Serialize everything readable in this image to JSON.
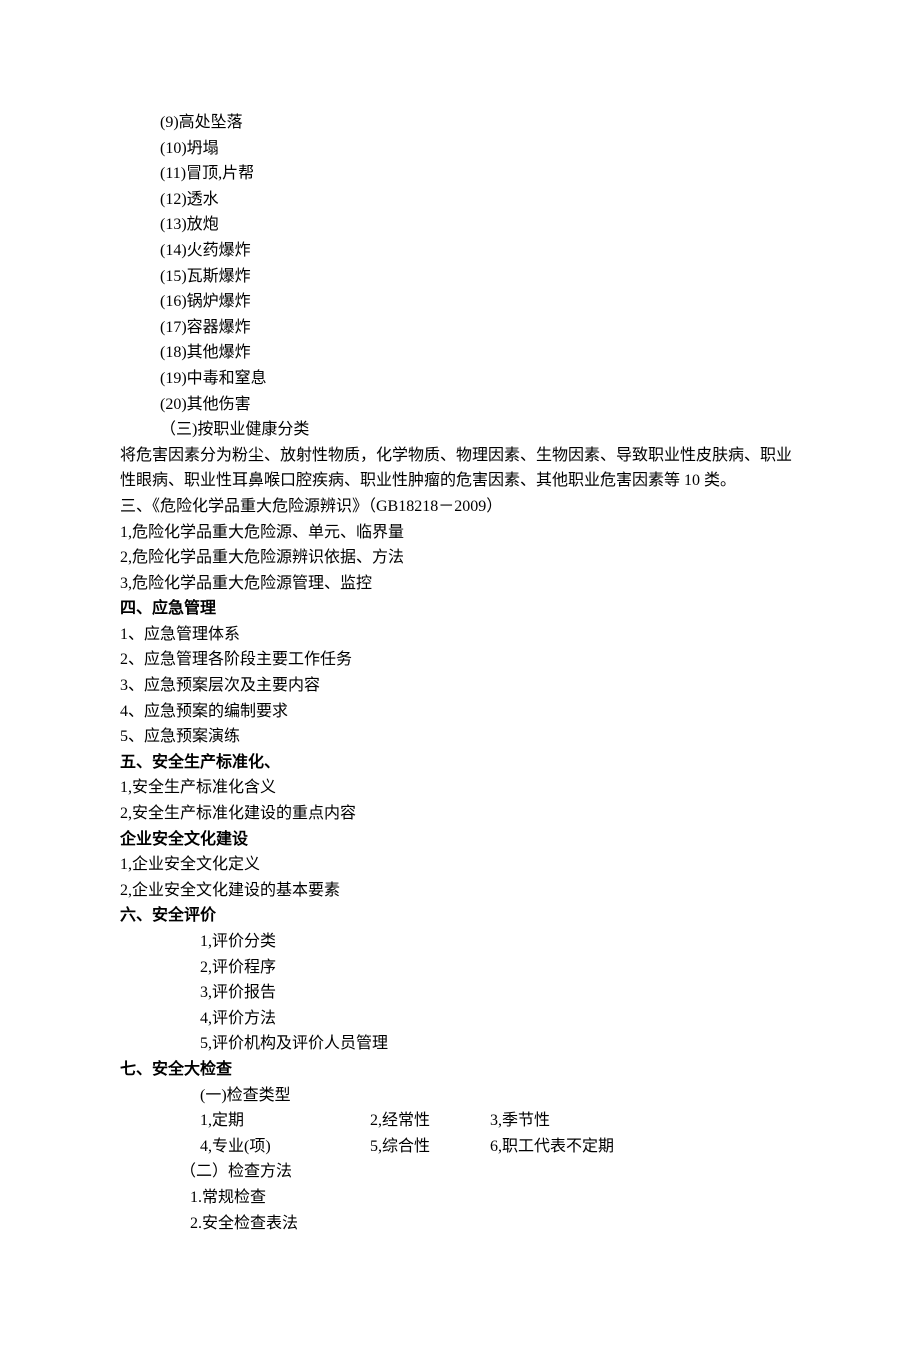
{
  "items_numbered": [
    "(9)高处坠落",
    "(10)坍塌",
    "(11)冒顶,片帮",
    "(12)透水",
    "(13)放炮",
    "(14)火药爆炸",
    "(15)瓦斯爆炸",
    "(16)锅炉爆炸",
    "(17)容器爆炸",
    "(18)其他爆炸",
    "(19)中毒和窒息",
    "(20)其他伤害"
  ],
  "section3_sub": "（三)按职业健康分类",
  "paragraph1": "将危害因素分为粉尘、放射性物质，化学物质、物理因素、生物因素、导致职业性皮肤病、职业性眼病、职业性耳鼻喉口腔疾病、职业性肿瘤的危害因素、其他职业危害因素等 10 类。",
  "section3_title": "三、《危险化学品重大危险源辨识》（GB18218－2009）",
  "section3_items": [
    "1,危险化学品重大危险源、单元、临界量",
    "2,危险化学品重大危险源辨识依据、方法",
    "3,危险化学品重大危险源管理、监控"
  ],
  "section4_title": "四、应急管理",
  "section4_items": [
    "1、应急管理体系",
    "2、应急管理各阶段主要工作任务",
    "3、应急预案层次及主要内容",
    "4、应急预案的编制要求",
    "5、应急预案演练"
  ],
  "section5_title": "五、安全生产标准化、",
  "section5_items": [
    "1,安全生产标准化含义",
    "2,安全生产标准化建设的重点内容"
  ],
  "section5b_title": "企业安全文化建设",
  "section5b_items": [
    "1,企业安全文化定义",
    "2,企业安全文化建设的基本要素"
  ],
  "section6_title": "六、安全评价",
  "section6_items": [
    "1,评价分类",
    "2,评价程序",
    "3,评价报告",
    "4,评价方法",
    "5,评价机构及评价人员管理"
  ],
  "section7_title": "七、安全大检查",
  "section7_sub1": "(一)检查类型",
  "section7_row1": {
    "a": "1,定期",
    "b": "2,经常性",
    "c": "3,季节性"
  },
  "section7_row2": {
    "a": "4,专业(项)",
    "b": "5,综合性",
    "c": "6,职工代表不定期"
  },
  "section7_sub2": "（二）检查方法",
  "section7_sub2_items": [
    "1.常规检查",
    "2.安全检查表法"
  ]
}
